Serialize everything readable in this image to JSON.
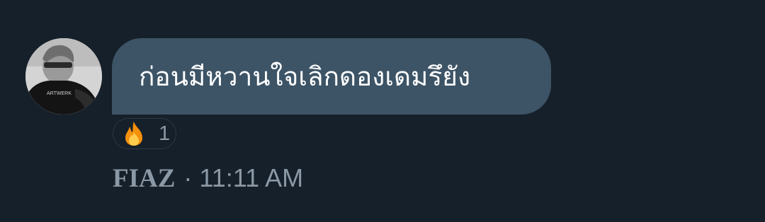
{
  "message": {
    "text": "ก่อนมีหวานใจเลิกดองเดมรึยัง"
  },
  "reaction": {
    "emoji_icon": "fire-icon",
    "count": "1"
  },
  "meta": {
    "sender": "FIAZ",
    "separator": "·",
    "time": "11:11 AM"
  },
  "colors": {
    "background": "#16202a",
    "bubble": "#3d5466",
    "muted_text": "#8b98a5"
  }
}
